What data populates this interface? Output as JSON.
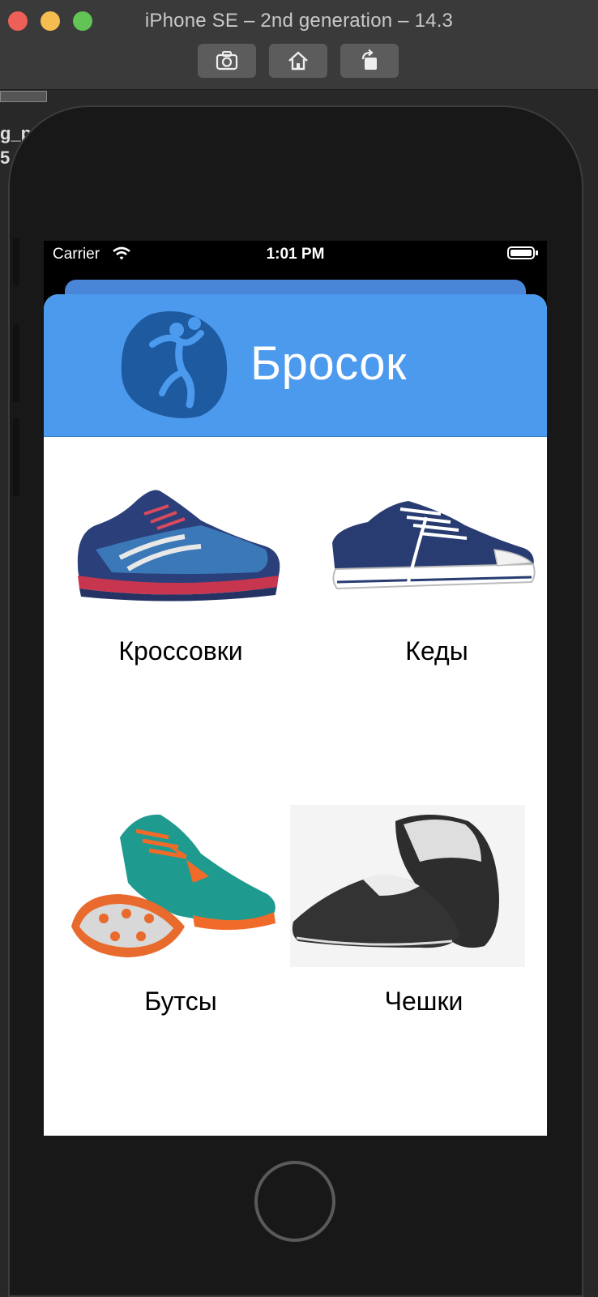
{
  "window": {
    "title": "iPhone SE – 2nd generation – 14.3",
    "toolbar": [
      "screenshot-button",
      "home-button",
      "rotate-button"
    ],
    "background_text": "g_p\n5"
  },
  "status_bar": {
    "carrier": "Carrier",
    "time": "1:01 PM"
  },
  "app": {
    "title": "Бросок",
    "header_color": "#4b9aee",
    "logo_icon": "handball-player-icon"
  },
  "categories": [
    {
      "label": "Кроссовки",
      "image": "running-shoe-image"
    },
    {
      "label": "Кеды",
      "image": "canvas-sneaker-image"
    },
    {
      "label": "Бутсы",
      "image": "football-boot-image"
    },
    {
      "label": "Чешки",
      "image": "ballet-slipper-image"
    }
  ]
}
